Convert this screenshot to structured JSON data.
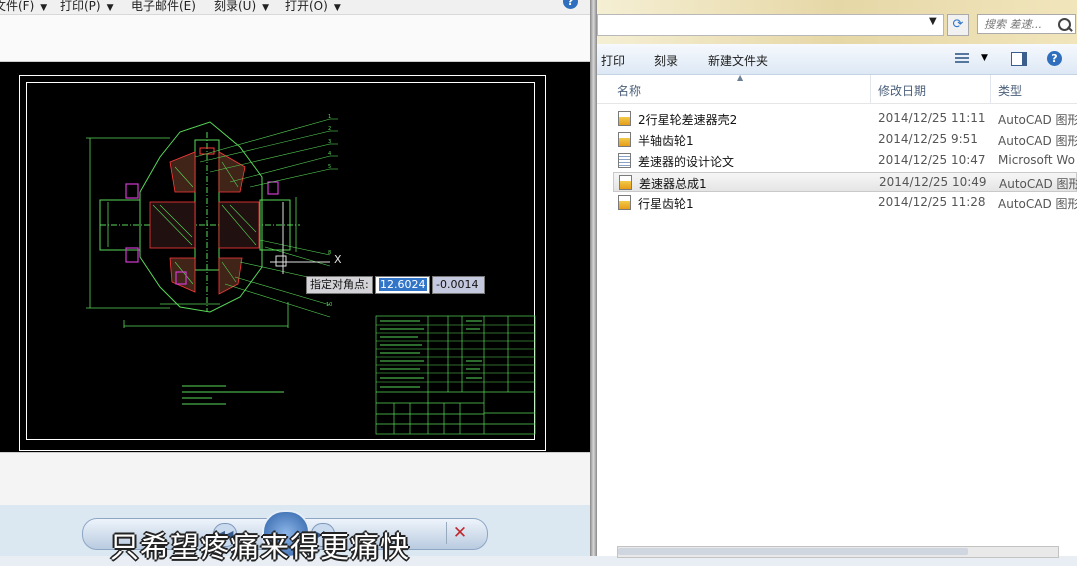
{
  "cad_window": {
    "menu": [
      {
        "label": "文件(F)"
      },
      {
        "label": "打印(P)"
      },
      {
        "label": "电子邮件(E)"
      },
      {
        "label": "刻录(U)"
      },
      {
        "label": "打开(O)"
      }
    ],
    "command_prompt": {
      "label": "指定对角点:",
      "x_value": "12.6024",
      "y_value": "-0.0014"
    },
    "drawing": {
      "callout_numbers": [
        "1",
        "2",
        "3",
        "4",
        "5",
        "8",
        "9",
        "10"
      ],
      "axis_marker": "X"
    }
  },
  "media_player": {
    "subtitle": "只希望疼痛来得更痛快",
    "close_glyph": "✕"
  },
  "explorer": {
    "search_placeholder": "搜索 差速...",
    "toolbar": {
      "print": "打印",
      "burn": "刻录",
      "new_folder": "新建文件夹"
    },
    "columns": {
      "name": "名称",
      "modified": "修改日期",
      "type": "类型"
    },
    "files": [
      {
        "name": "2行星轮差速器壳2",
        "modified": "2014/12/25 11:11",
        "type": "AutoCAD 图形",
        "icon": "autocad-file-icon"
      },
      {
        "name": "半轴齿轮1",
        "modified": "2014/12/25 9:51",
        "type": "AutoCAD 图形",
        "icon": "autocad-file-icon"
      },
      {
        "name": "差速器的设计论文",
        "modified": "2014/12/25 10:47",
        "type": "Microsoft Wo",
        "icon": "word-document-icon"
      },
      {
        "name": "差速器总成1",
        "modified": "2014/12/25 10:49",
        "type": "AutoCAD 图形",
        "icon": "autocad-file-icon",
        "selected": true
      },
      {
        "name": "行星齿轮1",
        "modified": "2014/12/25 11:28",
        "type": "AutoCAD 图形",
        "icon": "autocad-file-icon"
      }
    ]
  },
  "colors": {
    "cad_background": "#000000",
    "cad_lines": "#58d858",
    "cad_section": "#ff3b3b",
    "selection_blue": "#3175c9"
  }
}
